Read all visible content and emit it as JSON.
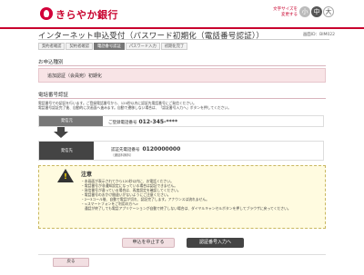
{
  "header": {
    "brand_name": "きらやか銀行",
    "font_size_label": "文字サイズを変更する",
    "font_size_small": "小",
    "font_size_medium": "中",
    "font_size_large": "大",
    "brand_color": "#c8002d"
  },
  "screen_id": "画面ID：BIM022",
  "page": {
    "title": "インターネット申込受付（パスワード初期化（電話番号認証））"
  },
  "steps": [
    {
      "label": "契約者確認",
      "active": false
    },
    {
      "label": "契約者確認",
      "active": false
    },
    {
      "label": "電話番号認証",
      "active": true
    },
    {
      "label": "パスワード入力",
      "active": false
    },
    {
      "label": "初期化完了",
      "active": false
    }
  ],
  "application_type": {
    "heading": "お申込種別",
    "value": "追加認証（会員宛）初期化"
  },
  "phone_auth": {
    "heading": "電話番号認証",
    "instruction_1": "電話番号での認証を行います。ご登録電話番号から、120秒以内に認証先電話番号にご発信ください。",
    "instruction_2": "電話番号認証完了後、自動的に次画面へ進みます。自動で遷移しない場合は、「認証番号入力へ」ボタンを押してください。",
    "caller_tag": "発信元",
    "caller_label": "ご登録電話番号",
    "caller_number": "012-345-****",
    "dest_tag": "発信先",
    "dest_label": "認証先電話番号",
    "dest_number": "0120000000",
    "dest_note": "（通話料無料）"
  },
  "warning": {
    "title": "注意",
    "items": [
      "・本画面が表示されてから120秒以内に、お電話ください。",
      "・電話番号が非通知設定になっている場合は認証できません。",
      "・発信番号が違っている場合は、再度設定を確認してください。",
      "・電話番号のおかけ間違いがないようにご注意ください。",
      "・2～3コール後、自動で電話が切れ、認証完了します。アナウンスは流れません。",
      "・<スマートフォンをご利用の方へ>",
      "　通話が終了しても電話アプリケーションが自動で終了しない場合は、ダイヤルキャンセルボタンを押してブラウザに戻ってください。"
    ]
  },
  "buttons": {
    "cancel": "申込を中止する",
    "next": "認証番号入力へ",
    "back": "戻る"
  }
}
